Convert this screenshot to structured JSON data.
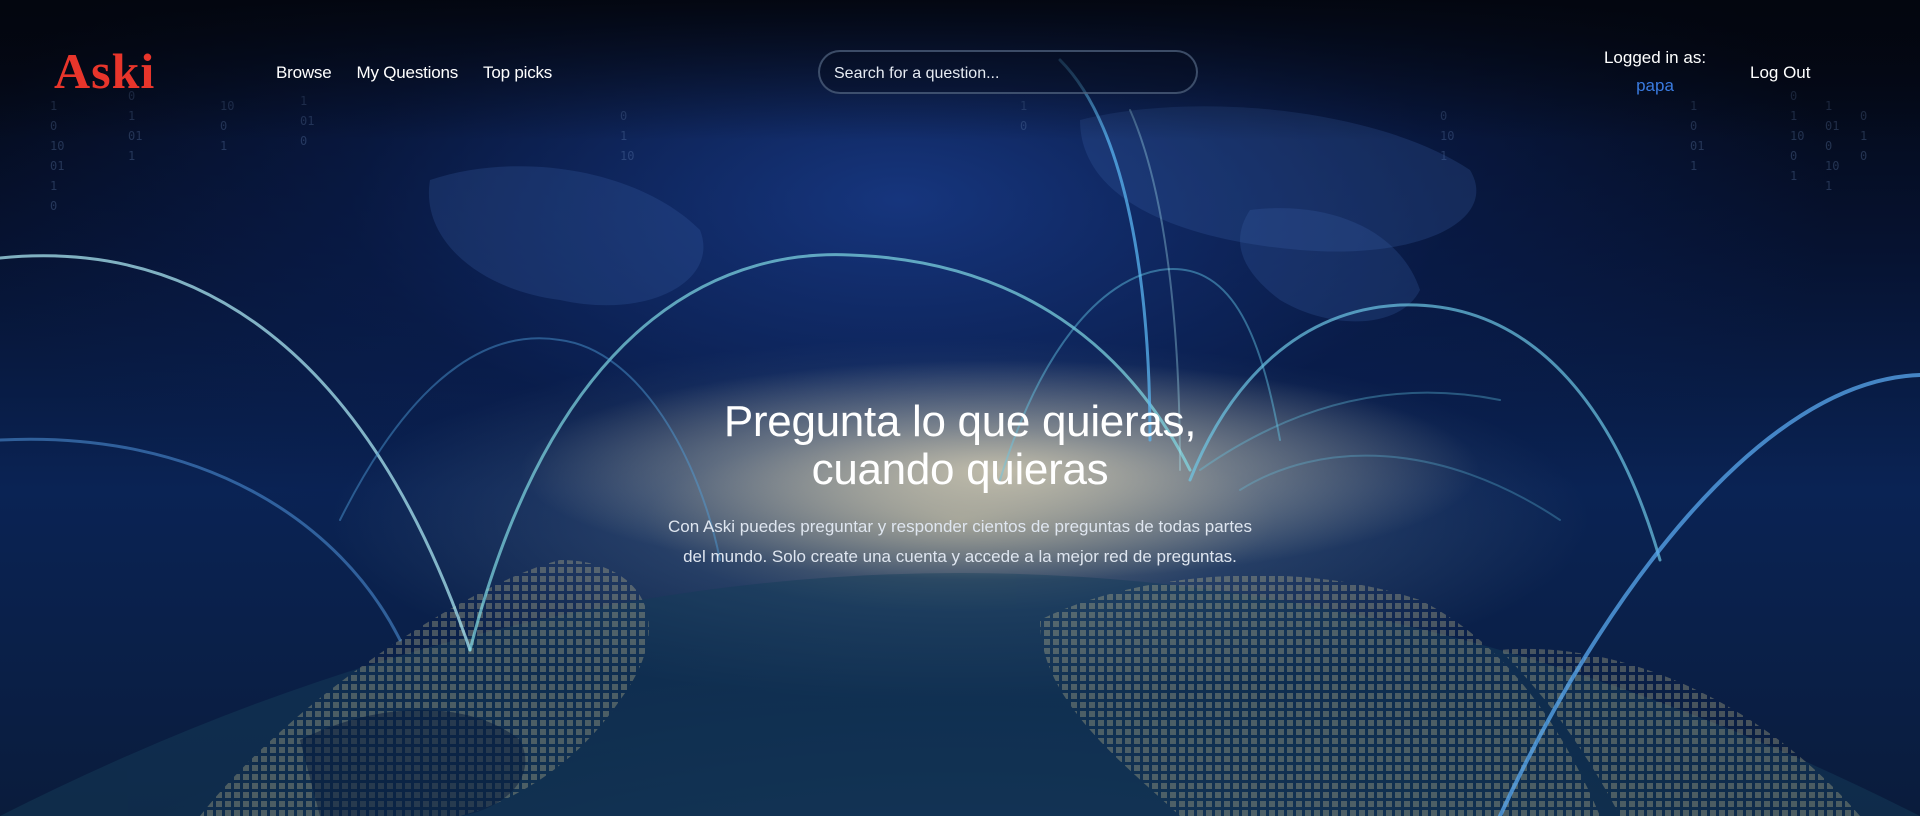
{
  "brand": {
    "logo_text": "Aski",
    "logo_color": "#e8352b"
  },
  "nav": {
    "items": [
      {
        "label": "Browse"
      },
      {
        "label": "My Questions"
      },
      {
        "label": "Top picks"
      }
    ]
  },
  "search": {
    "placeholder": "Search for a question...",
    "value": ""
  },
  "user": {
    "logged_in_label": "Logged in as:",
    "username": "papa",
    "username_color": "#3a7be0"
  },
  "logout": {
    "label": "Log Out"
  },
  "hero": {
    "title_line1": "Pregunta lo que quieras,",
    "title_line2": "cuando quieras",
    "description_line1": "Con Aski puedes preguntar y responder cientos de preguntas de todas partes",
    "description_line2": "del mundo. Solo create una cuenta y accede a la mejor red de preguntas."
  },
  "background": {
    "theme": "digital globe with glowing network arcs and binary code rain",
    "accent_color": "#3fb8e8"
  }
}
